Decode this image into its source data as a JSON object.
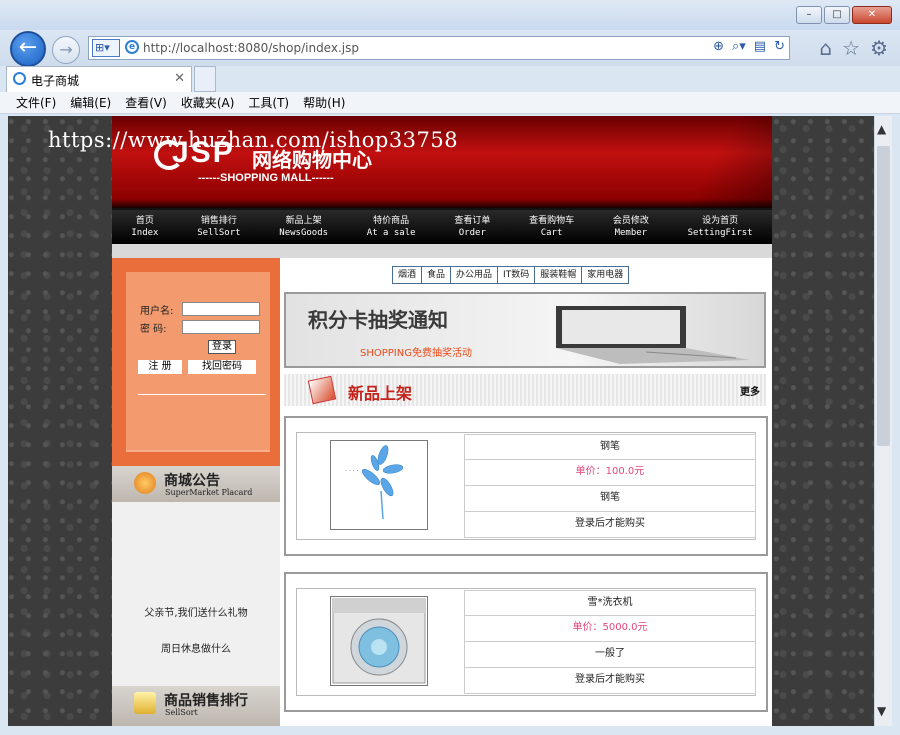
{
  "browser": {
    "window_controls": [
      "–",
      "□",
      "✕"
    ],
    "url_host": "http://localhost",
    "url_rest": ":8080/shop/index.jsp",
    "tab_title": "电子商城",
    "menu": [
      "文件(F)",
      "编辑(E)",
      "查看(V)",
      "收藏夹(A)",
      "工具(T)",
      "帮助(H)"
    ]
  },
  "site": {
    "watermark": "https://www.huzhan.com/ishop33758",
    "logo": "JSP",
    "logo_zh": "网络购物中心",
    "logo_sub": "------SHOPPING MALL------",
    "nav": [
      {
        "zh": "首页",
        "en": "Index"
      },
      {
        "zh": "销售排行",
        "en": "SellSort"
      },
      {
        "zh": "新品上架",
        "en": "NewsGoods"
      },
      {
        "zh": "特价商品",
        "en": "At a sale"
      },
      {
        "zh": "查看订单",
        "en": "Order"
      },
      {
        "zh": "查看购物车",
        "en": "Cart"
      },
      {
        "zh": "会员修改",
        "en": "Member"
      },
      {
        "zh": "设为首页",
        "en": "SettingFirst"
      }
    ],
    "login": {
      "username_label": "用户名:",
      "password_label": "密  码:",
      "login_button": "登录",
      "register_button": "注   册",
      "forgot_button": "找回密码"
    },
    "notice_section": {
      "zh": "商城公告",
      "en": "SuperMarket Placard"
    },
    "notices": [
      "父亲节,我们送什么礼物",
      "周日休息做什么"
    ],
    "sellsort_section": {
      "zh": "商品销售排行",
      "en": "SellSort"
    },
    "categories": [
      "烟酒",
      "食品",
      "办公用品",
      "IT数码",
      "服装鞋帽",
      "家用电器"
    ],
    "promo": {
      "title": "积分卡抽奖通知",
      "subtitle": "SHOPPING免费抽奖活动"
    },
    "new_goods": {
      "title": "新品上架",
      "more": "更多"
    },
    "products": [
      {
        "name": "钢笔",
        "price": "单价：100.0元",
        "desc": "钢笔",
        "action": "登录后才能购买"
      },
      {
        "name": "雪*洗衣机",
        "price": "单价：5000.0元",
        "desc": "一般了",
        "action": "登录后才能购买"
      }
    ]
  }
}
